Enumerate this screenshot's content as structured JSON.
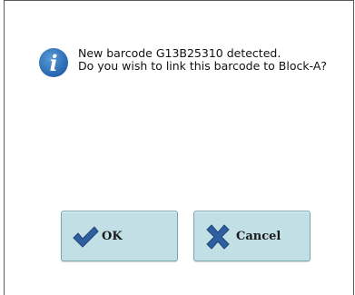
{
  "dialog": {
    "message_line1": "New barcode G13B25310 detected.",
    "message_line2": "Do you wish to link this barcode to Block-A?",
    "icon": "info-icon"
  },
  "buttons": {
    "ok": {
      "label": "OK",
      "icon": "checkmark-icon"
    },
    "cancel": {
      "label": "Cancel",
      "icon": "x-icon"
    }
  },
  "colors": {
    "icon_blue": "#2b6cb3",
    "button_fill": "#c2dfe6",
    "button_border": "#7aa7b2"
  }
}
